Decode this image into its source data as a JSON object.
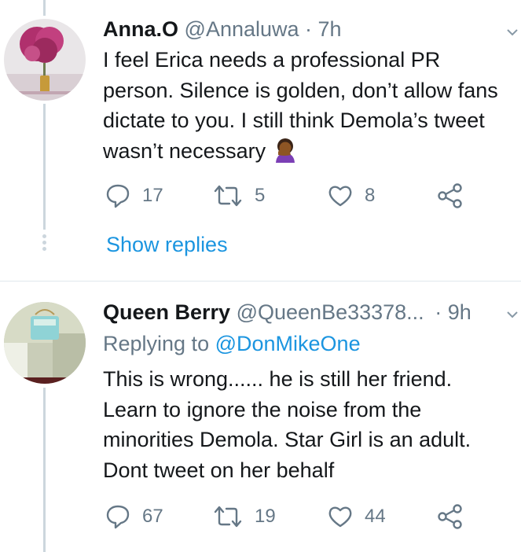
{
  "tweets": [
    {
      "display_name": "Anna.O",
      "handle": "@Annaluwa",
      "time": "· 7h",
      "text": "I feel Erica needs a professional PR person. Silence is golden, don’t allow fans dictate to you. I still think Demola’s tweet wasn’t necessary",
      "emoji": "woman-facepalming-emoji",
      "replies": "17",
      "retweets": "5",
      "likes": "8",
      "show_replies": "Show replies"
    },
    {
      "display_name": "Queen Berry",
      "handle": "@QueenBe33378...",
      "time": "· 9h",
      "replying_prefix": "Replying to",
      "replying_to": "@DonMikeOne",
      "text": "This is wrong...... he is still her friend. Learn to ignore the noise from the minorities Demola. Star Girl is an adult. Dont tweet on her behalf",
      "replies": "67",
      "retweets": "19",
      "likes": "44"
    }
  ],
  "colors": {
    "link": "#1b95e0",
    "muted": "#657786",
    "thread": "#ccd6dd"
  }
}
